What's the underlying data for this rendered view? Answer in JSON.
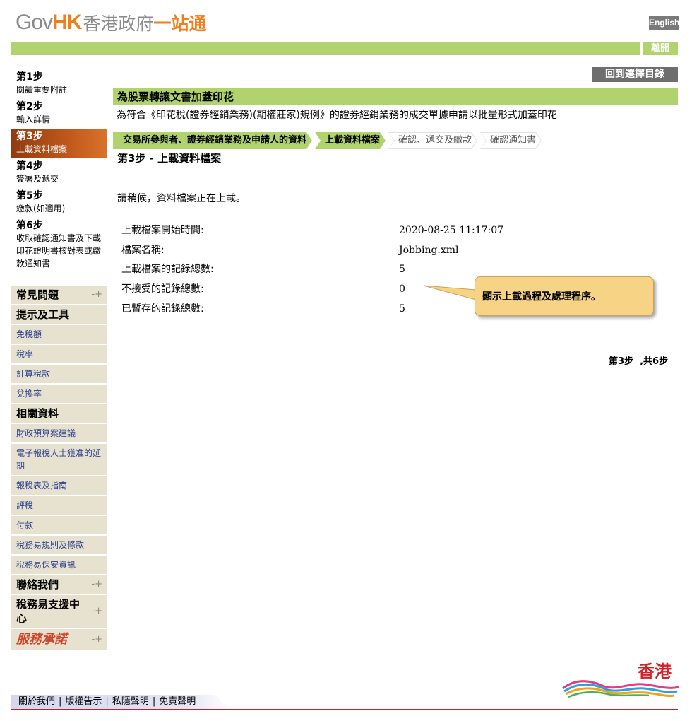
{
  "header": {
    "logo_gov": "Gov",
    "logo_hk": "HK",
    "logo_cn1": "香港政府",
    "logo_cn2": "一站通",
    "lang_button": "English",
    "logout_button": "離開"
  },
  "steps": [
    {
      "num": "第1步",
      "label": "閱讀重要附註",
      "active": false
    },
    {
      "num": "第2步",
      "label": "輸入詳情",
      "active": false
    },
    {
      "num": "第3步",
      "label": "上載資料檔案",
      "active": true
    },
    {
      "num": "第4步",
      "label": "簽署及遞交",
      "active": false
    },
    {
      "num": "第5步",
      "label": "繳款(如適用)",
      "active": false
    },
    {
      "num": "第6步",
      "label": "收取確認通知書及下載印花證明書核對表或繳款通知書",
      "active": false
    }
  ],
  "nav": {
    "faq": "常見問題",
    "tips_head": "提示及工具",
    "tips_items": [
      "免稅額",
      "稅率",
      "計算稅款",
      "兌換率"
    ],
    "related_head": "相關資料",
    "related_items": [
      "財政預算案建議",
      "電子報稅人士獲准的延期",
      "報稅表及指南",
      "評稅",
      "付款",
      "稅務易規則及條款",
      "稅務易保安資訊"
    ],
    "contact": "聯絡我們",
    "support": "稅務易支援中心",
    "pledge": "服務承諾",
    "plus_icon": "plus-icon"
  },
  "main": {
    "back_button": "回到選擇目錄",
    "title": "為股票轉讓文書加蓋印花",
    "subtitle": "為符合《印花稅(證券經銷業務)(期權莊家)規例》的證券經銷業務的成交單據申請以批量形式加蓋印花",
    "progress": [
      {
        "label": "交易所參與者、證券經銷業務及申請人的資料",
        "state": "done"
      },
      {
        "label": "上載資料檔案",
        "state": "done"
      },
      {
        "label": "確認、遞交及繳款",
        "state": "todo"
      },
      {
        "label": "確認通知書",
        "state": "todo"
      }
    ],
    "step_heading": "第3步  -  上載資料檔案",
    "wait_message": "請稍候，資料檔案正在上載。",
    "info": [
      {
        "key": "上載檔案開始時間:",
        "value": "2020-08-25 11:17:07"
      },
      {
        "key": "檔案名稱:",
        "value": "Jobbing.xml"
      },
      {
        "key": "上載檔案的記錄總數:",
        "value": "5"
      },
      {
        "key": "不接受的記錄總數:",
        "value": "0"
      },
      {
        "key": "已暫存的記錄總數:",
        "value": "5"
      }
    ],
    "callout": "顯示上載過程及處理程序。",
    "pager": "第3步  ,共6步"
  },
  "footer": {
    "links": [
      "關於我們",
      "版權告示",
      "私隱聲明",
      "免責聲明"
    ],
    "brand": "香港"
  },
  "colors": {
    "accent_green": "#b0d36e",
    "active_step": "#c0581c",
    "nav_bg": "#e6e2cf",
    "link_blue": "#2c3e8f",
    "callout_bg": "#f7d385",
    "footer_red": "#c0222a"
  }
}
